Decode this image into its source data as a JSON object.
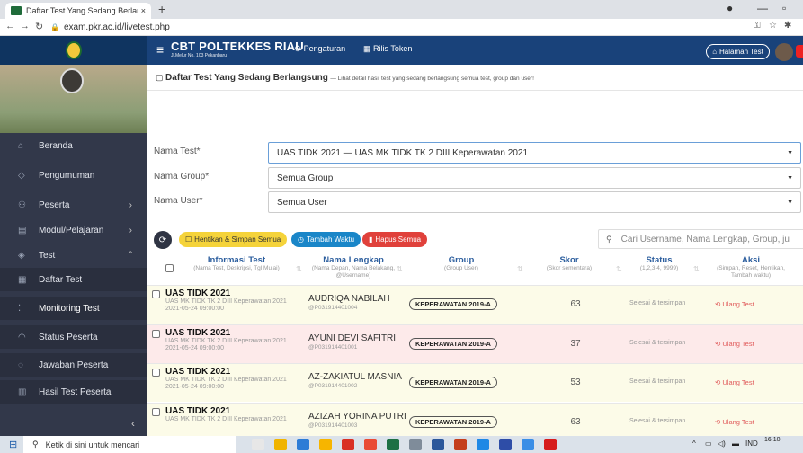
{
  "browser": {
    "tab_title": "Daftar Test Yang Sedang Berlang",
    "tab_close": "×",
    "new_tab": "+",
    "url": "exam.pkr.ac.id/livetest.php"
  },
  "topbar": {
    "brand_title": "CBT POLTEKKES RIAU",
    "brand_address": "Jl.Melur No. 103 Pekanbaru",
    "menu_settings": "Pengaturan",
    "menu_token": "Rilis Token",
    "home_test_button": "Halaman Test"
  },
  "sidebar": {
    "items": [
      {
        "label": "Beranda",
        "icon": "home-icon"
      },
      {
        "label": "Pengumuman",
        "icon": "announcement-icon"
      },
      {
        "label": "Peserta",
        "icon": "users-icon"
      },
      {
        "label": "Modul/Pelajaran",
        "icon": "book-icon"
      },
      {
        "label": "Test",
        "icon": "test-icon"
      },
      {
        "label": "Daftar Test",
        "icon": "list-icon"
      },
      {
        "label": "Monitoring Test",
        "icon": "monitor-icon"
      },
      {
        "label": "Status Peserta",
        "icon": "status-icon"
      },
      {
        "label": "Jawaban Peserta",
        "icon": "answer-icon"
      },
      {
        "label": "Hasil Test Peserta",
        "icon": "result-icon"
      }
    ],
    "collapse": "‹"
  },
  "header": {
    "title": "Daftar Test Yang Sedang Berlangsung",
    "subtitle": "— Lihat detail hasil test yang sedang berlangsung semua test, group dan user!"
  },
  "filters": {
    "test_label": "Nama Test*",
    "test_value": "UAS TIDK 2021 — UAS MK TIDK TK 2 DIII Keperawatan 2021",
    "group_label": "Nama Group*",
    "group_value": "Semua Group",
    "user_label": "Nama User*",
    "user_value": "Semua User"
  },
  "actions": {
    "stop_save": "Hentikan & Simpan Semua",
    "add_time": "Tambah Waktu",
    "delete_all": "Hapus Semua",
    "search_placeholder": "Cari Username, Nama Lengkap, Group, ju"
  },
  "table": {
    "headers": [
      {
        "title": "Informasi Test",
        "sub": "(Nama Test, Deskripsi, Tgl Mulai)"
      },
      {
        "title": "Nama Lengkap",
        "sub": "(Nama Depan, Nama Belakang, @Username)"
      },
      {
        "title": "Group",
        "sub": "(Group User)"
      },
      {
        "title": "Skor",
        "sub": "(Skor sementara)"
      },
      {
        "title": "Status",
        "sub": "(1,2,3,4, 9999)"
      },
      {
        "title": "Aksi",
        "sub": "(Simpan, Reset, Hentikan, Tambah waktu)"
      }
    ],
    "rows": [
      {
        "test": "UAS TIDK 2021",
        "desc": "UAS MK TIDK TK 2 DIII Keperawatan 2021",
        "date": "2021-05-24 09:00:00",
        "name": "AUDRIQA NABILAH",
        "user": "@P031914401004",
        "group": "KEPERAWATAN 2019-A",
        "score": "63",
        "status": "Selesai & tersimpan",
        "action": "Ulang Test",
        "bg": "#fcfbe8"
      },
      {
        "test": "UAS TIDK 2021",
        "desc": "UAS MK TIDK TK 2 DIII Keperawatan 2021",
        "date": "2021-05-24 09:00:00",
        "name": "AYUNI DEVI SAFITRI",
        "user": "@P031914401001",
        "group": "KEPERAWATAN 2019-A",
        "score": "37",
        "status": "Selesai & tersimpan",
        "action": "Ulang Test",
        "bg": "#fdeaea"
      },
      {
        "test": "UAS TIDK 2021",
        "desc": "UAS MK TIDK TK 2 DIII Keperawatan 2021",
        "date": "2021-05-24 09:00:00",
        "name": "AZ-ZAKIATUL MASNIA",
        "user": "@P031914401002",
        "group": "KEPERAWATAN 2019-A",
        "score": "53",
        "status": "Selesai & tersimpan",
        "action": "Ulang Test",
        "bg": "#fcfbe8"
      },
      {
        "test": "UAS TIDK 2021",
        "desc": "UAS MK TIDK TK 2 DIII Keperawatan 2021",
        "date": "",
        "name": "AZIZAH YORINA PUTRI",
        "user": "@P031914401003",
        "group": "KEPERAWATAN 2019-A",
        "score": "63",
        "status": "Selesai & tersimpan",
        "action": "Ulang Test",
        "bg": "#fcfbe8"
      }
    ]
  },
  "taskbar": {
    "search_placeholder": "Ketik di sini untuk mencari",
    "lang": "IND",
    "time": "16:10"
  },
  "colors": {
    "navbar": "#19427a",
    "sidebar": "#32384a",
    "accent_yellow": "#f5d33a",
    "accent_blue": "#1a86c8",
    "accent_red": "#e0413b"
  }
}
